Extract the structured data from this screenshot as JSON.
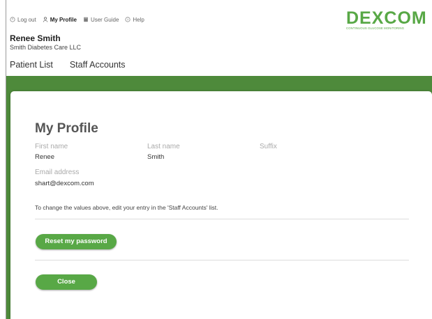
{
  "topbar": {
    "logout": "Log out",
    "profile": "My Profile",
    "guide": "User Guide",
    "help": "Help"
  },
  "logo": {
    "word": "DEXCOM",
    "tagline": "CONTINUOUS GLUCOSE MONITORING"
  },
  "user": {
    "name": "Renee Smith",
    "org": "Smith Diabetes Care LLC"
  },
  "nav": {
    "patients": "Patient List",
    "staff": "Staff Accounts"
  },
  "profile": {
    "title": "My Profile",
    "first_name_label": "First name",
    "first_name": "Renee",
    "last_name_label": "Last name",
    "last_name": "Smith",
    "suffix_label": "Suffix",
    "suffix": "",
    "email_label": "Email address",
    "email": "shart@dexcom.com",
    "note": "To change the values above, edit your entry in the 'Staff Accounts' list.",
    "reset_button": "Reset my password",
    "close_button": "Close"
  },
  "colors": {
    "brand_green": "#58a846",
    "band_green": "#4e8a3b"
  }
}
